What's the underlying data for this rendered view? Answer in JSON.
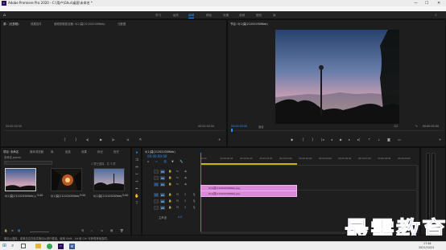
{
  "window": {
    "title": "Adobe Premiere Pro 2020 - C:\\用户\\Ghui\\桌面\\未命名 *",
    "min": "—",
    "max": "☐",
    "close": "✕"
  },
  "menu": [
    "文件(F)",
    "编辑(E)",
    "剪辑(C)",
    "序列(S)",
    "标记(M)",
    "图形(G)",
    "视图(V)",
    "窗口(W)",
    "帮助(H)"
  ],
  "workspaces": [
    {
      "label": "学习",
      "active": false
    },
    {
      "label": "组件",
      "active": false
    },
    {
      "label": "编辑",
      "active": true
    },
    {
      "label": "颜色",
      "active": false
    },
    {
      "label": "效果",
      "active": false
    },
    {
      "label": "音频",
      "active": false
    },
    {
      "label": "图形",
      "active": false
    },
    {
      "label": "库",
      "active": false
    }
  ],
  "source_panel": {
    "tabs": [
      "源：(无剪辑)",
      "效果控件",
      "音频剪辑混合器: 0(1)莫(21202030Web)",
      "元数据"
    ],
    "timecode_left": "00:00:00:00",
    "timecode_right": "00:00:00:00"
  },
  "program_panel": {
    "tab": "节目: 0(1)莫(21202030Web)",
    "timecode_left": "00:00:00:00",
    "fit": "适合",
    "fraction": "1/2",
    "timecode_right": "00:00:05:00"
  },
  "project_panel": {
    "tabs": [
      "项目: 未命名",
      "媒体浏览器",
      "库",
      "信息",
      "效果",
      "标记",
      "历史"
    ],
    "file": "未命名.prproj",
    "count": "1 项已选择，共 3 项",
    "items": [
      {
        "name": "0(1)莫(21202030Web).jpg",
        "duration": "5:00",
        "selected": true
      },
      {
        "name": "0(1)莫(21202030Web).jpg",
        "duration": "5:00",
        "selected": false
      },
      {
        "name": "0(1)莫(21202030Web).jpg",
        "duration": "5:00",
        "selected": false
      }
    ]
  },
  "timeline": {
    "tab": "0(1)莫(21202030Web)",
    "timecode": "00:00:00:00",
    "ruler": [
      "00:00",
      "00:00:00:00",
      "00:00:01:00",
      "00:00:02:00",
      "00:00:03:00",
      "00:00:04:00",
      "00:00:05:00",
      "00:00:06:00",
      "00:00:07:00",
      "00:00:08:00",
      "00:00:09:00"
    ],
    "video_tracks": [
      "V3",
      "V2",
      "V1"
    ],
    "audio_tracks": [
      "A1",
      "A2",
      "A3"
    ],
    "master": "主声道",
    "master_value": "0.0",
    "clips": [
      "0(1)莫(21202030Web).jpg",
      "0(1)莫(21202030Web).jpg"
    ]
  },
  "status": "单击以选择，或单击空白处并拖动以进行框选。使用 Shift、Alt 和 Ctrl 可获得其他选项。",
  "watermark": "最需教育",
  "clock": {
    "time": "17:46",
    "date": "2021/10/24"
  },
  "colors": {
    "accent": "#2d8ceb",
    "clip": "#d98bd9"
  }
}
